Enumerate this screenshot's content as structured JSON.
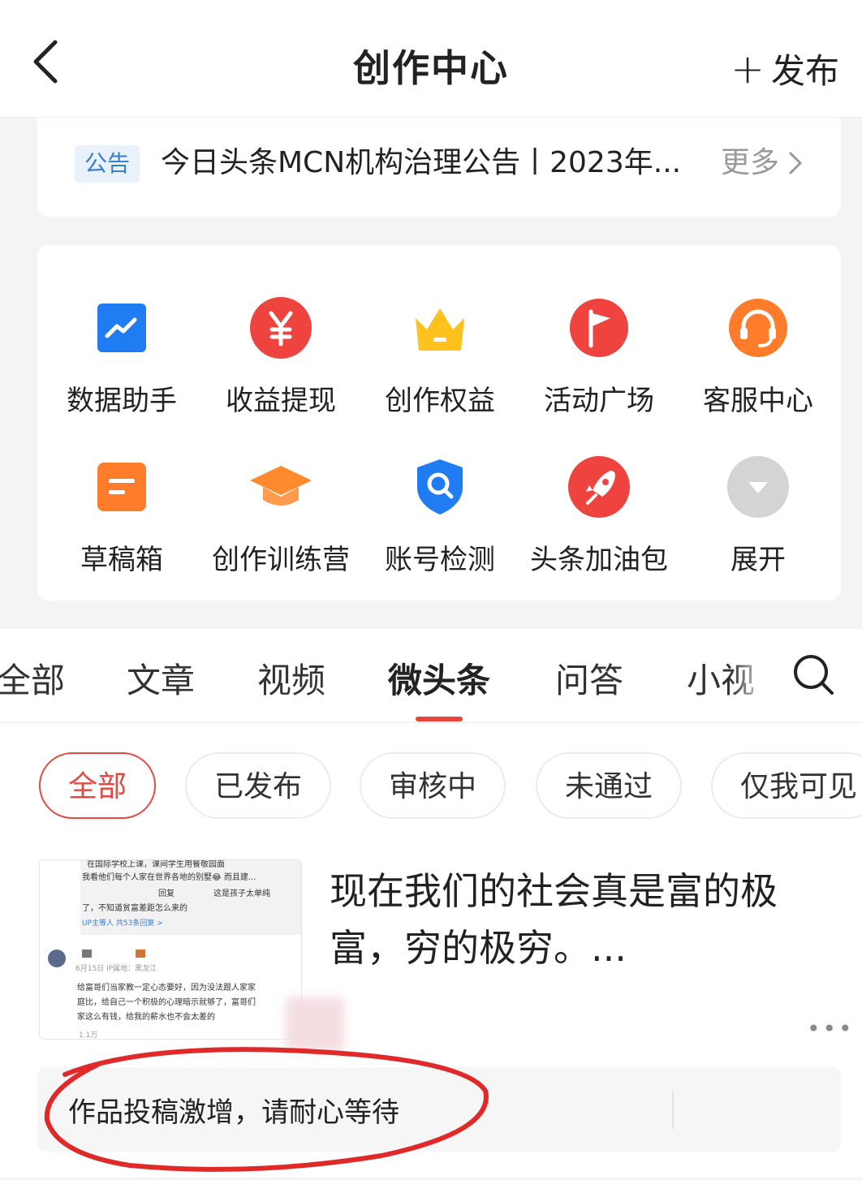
{
  "header": {
    "title": "创作中心",
    "publish_label": "发布"
  },
  "notice": {
    "tag": "公告",
    "text": "今日头条MCN机构治理公告丨2023年...",
    "more_label": "更多"
  },
  "tools": {
    "items": [
      {
        "label": "数据助手",
        "icon": "chart-trend-icon",
        "color": "#1f7cf2"
      },
      {
        "label": "收益提现",
        "icon": "yuan-icon",
        "color": "#ef4340"
      },
      {
        "label": "创作权益",
        "icon": "crown-icon",
        "color": "#ffc21c"
      },
      {
        "label": "活动广场",
        "icon": "flag-icon",
        "color": "#ef4340"
      },
      {
        "label": "客服中心",
        "icon": "headset-icon",
        "color": "#ff7d2a"
      },
      {
        "label": "草稿箱",
        "icon": "draft-icon",
        "color": "#ff7d2a"
      },
      {
        "label": "创作训练营",
        "icon": "graduation-cap-icon",
        "color": "#ff8a2d"
      },
      {
        "label": "账号检测",
        "icon": "shield-search-icon",
        "color": "#1f7cf2"
      },
      {
        "label": "头条加油包",
        "icon": "rocket-icon",
        "color": "#ef4340"
      },
      {
        "label": "展开",
        "icon": "expand-icon",
        "color": "#cfcfcf"
      }
    ]
  },
  "tabs": {
    "items": [
      "全部",
      "文章",
      "视频",
      "微头条",
      "问答",
      "小视"
    ],
    "active": "微头条"
  },
  "filters": {
    "items": [
      "全部",
      "已发布",
      "审核中",
      "未通过",
      "仅我可见"
    ],
    "active": "全部"
  },
  "post": {
    "title": "现在我们的社会真是富的极富，穷的极穷。...",
    "thumb": {
      "line1": "在国际学校上课，课间学生用餐敬园面",
      "line2": "我看他们每个人家在世界各地的别墅😂 而且建...",
      "line3": "回复",
      "line4": "这是孩子太单纯",
      "line5": "了，不知道贫富差距怎么来的",
      "line6": "UP主等人 共53条回复 >",
      "meta": "6月15日 IP属地：黑龙江",
      "body1": "给富哥们当家教一定心态要好，因为没法跟人家家",
      "body2": "庭比，给自己一个积极的心理暗示就够了，富哥们",
      "body3": "家这么有钱，给我的薪水也不会太差的",
      "likes": "1.1万"
    }
  },
  "status": {
    "text": "作品投稿激增，请耐心等待"
  }
}
